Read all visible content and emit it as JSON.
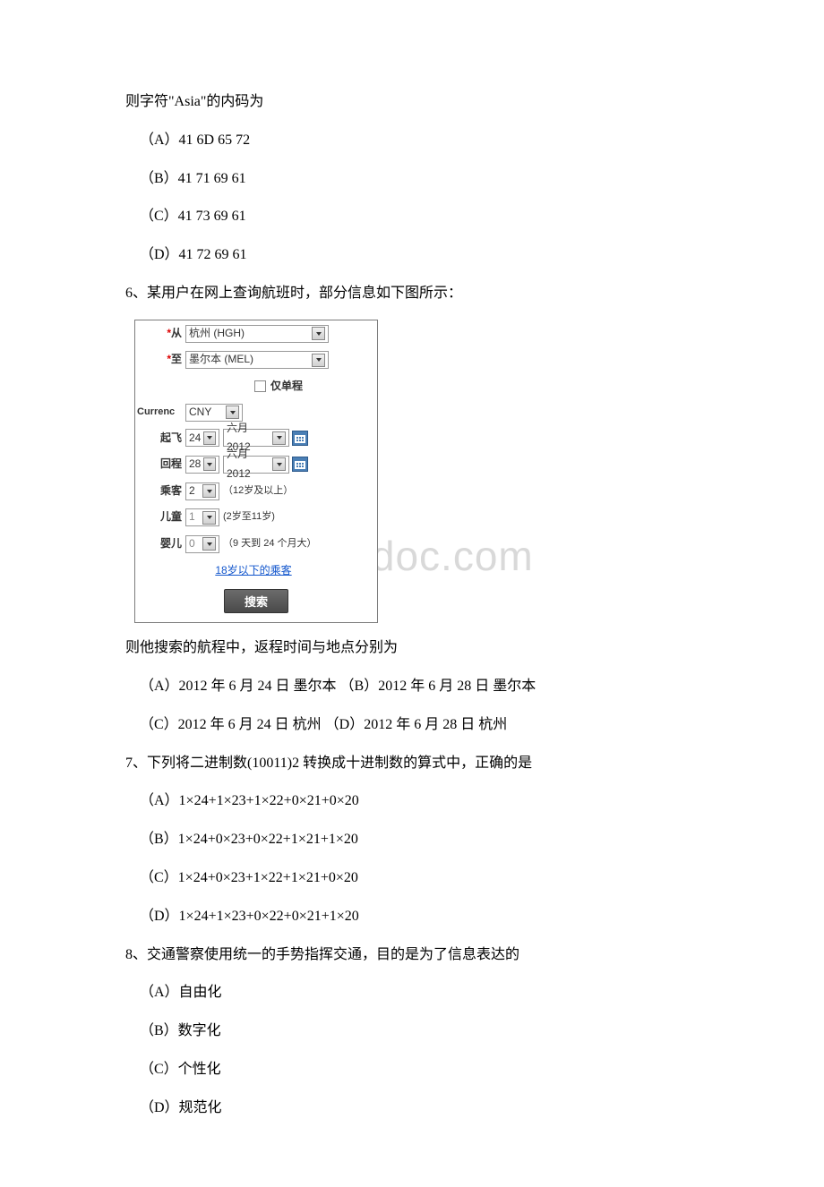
{
  "q5_tail": {
    "prompt": "则字符\"Asia\"的内码为",
    "optA": "（A）41 6D 65 72",
    "optB": "（B）41 71 69 61",
    "optC": "（C）41 73 69 61",
    "optD": "（D）41 72 69 61"
  },
  "q6": {
    "stem": "6、某用户在网上查询航班时，部分信息如下图所示：",
    "after": "则他搜索的航程中，返程时间与地点分别为",
    "optA": "（A）2012 年 6 月 24 日 墨尔本 （B）2012 年 6 月 28 日 墨尔本",
    "optC": "（C）2012 年 6 月 24 日 杭州 （D）2012 年 6 月 28 日 杭州",
    "form": {
      "from_label": "从",
      "from_value": "杭州 (HGH)",
      "to_label": "至",
      "to_value": "墨尔本 (MEL)",
      "oneway_label": "仅单程",
      "currency_label": "Currenc",
      "currency_value": "CNY",
      "depart_label": "起飞",
      "depart_day": "24",
      "depart_month": "六月 2012",
      "return_label": "回程",
      "return_day": "28",
      "return_month": "六月 2012",
      "pax_label": "乘客",
      "pax_value": "2",
      "pax_hint": "（12岁及以上）",
      "child_label": "儿童",
      "child_value": "1",
      "child_hint": "(2岁至11岁)",
      "infant_label": "婴儿",
      "infant_value": "0",
      "infant_hint": "（9 天到 24 个月大）",
      "minor_link": "18岁以下的乘客",
      "search_btn": "搜索"
    }
  },
  "q7": {
    "stem": "7、下列将二进制数(10011)2 转换成十进制数的算式中，正确的是",
    "optA": "（A）1×24+1×23+1×22+0×21+0×20",
    "optB": "（B）1×24+0×23+0×22+1×21+1×20",
    "optC": "（C）1×24+0×23+1×22+1×21+0×20",
    "optD": "（D）1×24+1×23+0×22+0×21+1×20"
  },
  "q8": {
    "stem": "8、交通警察使用统一的手势指挥交通，目的是为了信息表达的",
    "optA": "（A）自由化",
    "optB": "（B）数字化",
    "optC": "（C）个性化",
    "optD": "（D）规范化"
  },
  "watermark": "www.bingdoc.com"
}
